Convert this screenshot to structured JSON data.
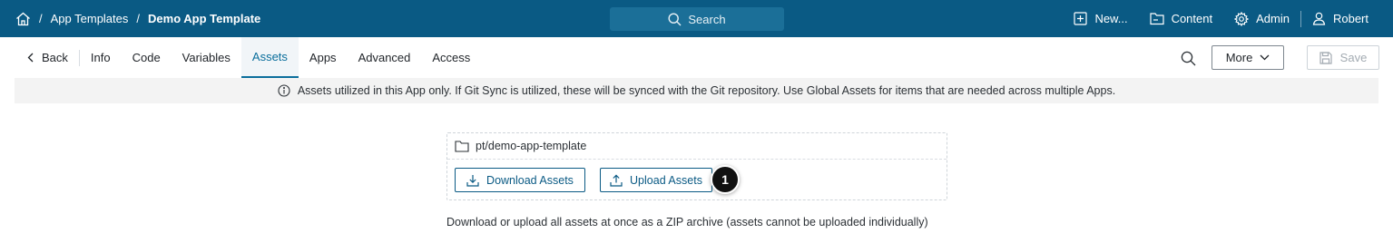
{
  "breadcrumb": {
    "home_icon": "home-icon",
    "separator": "/",
    "items": [
      "App Templates",
      "Demo App Template"
    ]
  },
  "search": {
    "label": "Search",
    "icon": "search-icon"
  },
  "top_nav": {
    "new": "New...",
    "content": "Content",
    "admin": "Admin",
    "user": "Robert"
  },
  "tabs": {
    "back": "Back",
    "items": [
      "Info",
      "Code",
      "Variables",
      "Assets",
      "Apps",
      "Advanced",
      "Access"
    ],
    "active": "Assets"
  },
  "toolbar": {
    "more_label": "More",
    "save_label": "Save"
  },
  "banner": {
    "text": "Assets utilized in this App only. If Git Sync is utilized, these will be synced with the Git repository. Use Global Assets for items that are needed across multiple Apps."
  },
  "assets": {
    "path": "pt/demo-app-template",
    "download_label": "Download Assets",
    "upload_label": "Upload Assets",
    "step_badge": "1",
    "help_text": "Download or upload all assets at once as a ZIP archive (assets cannot be uploaded individually)"
  },
  "colors": {
    "topbar": "#0a5a84",
    "accent": "#0a6e9c",
    "banner_bg": "#f3f3f3"
  }
}
